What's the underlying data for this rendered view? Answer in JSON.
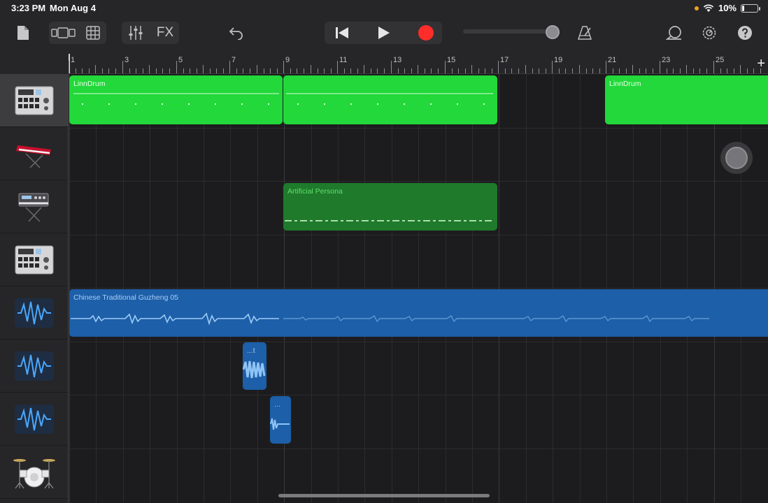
{
  "status": {
    "time": "3:23 PM",
    "date": "Mon Aug 4",
    "battery": "10%"
  },
  "toolbar": {
    "fx_label": "FX",
    "icons": [
      "my-songs-icon",
      "view-toggle-icon",
      "grid-icon",
      "mixer-icon",
      "undo-icon",
      "rewind-icon",
      "play-icon",
      "record-icon",
      "metronome-icon",
      "loop-browser-icon",
      "settings-icon",
      "help-icon"
    ],
    "record_color": "#ff2d2a"
  },
  "ruler": {
    "labels": [
      "1",
      "3",
      "5",
      "7",
      "9",
      "11",
      "13",
      "15",
      "17",
      "19",
      "21",
      "23",
      "25"
    ],
    "add_label": "+"
  },
  "tracks": [
    {
      "instrument": "drum-machine-icon",
      "selected": true
    },
    {
      "instrument": "keyboard-icon",
      "selected": false
    },
    {
      "instrument": "synth-keyboard-icon",
      "selected": false
    },
    {
      "instrument": "drum-machine-icon",
      "selected": false
    },
    {
      "instrument": "audio-waveform-icon",
      "selected": false
    },
    {
      "instrument": "audio-waveform-icon",
      "selected": false
    },
    {
      "instrument": "audio-waveform-icon",
      "selected": false
    },
    {
      "instrument": "drum-kit-icon",
      "selected": false
    }
  ],
  "regions": {
    "linndrum_1": "LinnDrum",
    "linndrum_2": "LinnDrum",
    "artificial_persona": "Artificial Persona",
    "guzheng": "Chinese Traditional Guzheng 05",
    "clip_a": "...t",
    "clip_b": "..."
  },
  "colors": {
    "drum_region": "#22d83a",
    "midi_region": "#1f7a2c",
    "audio_region": "#1d5fa8"
  }
}
